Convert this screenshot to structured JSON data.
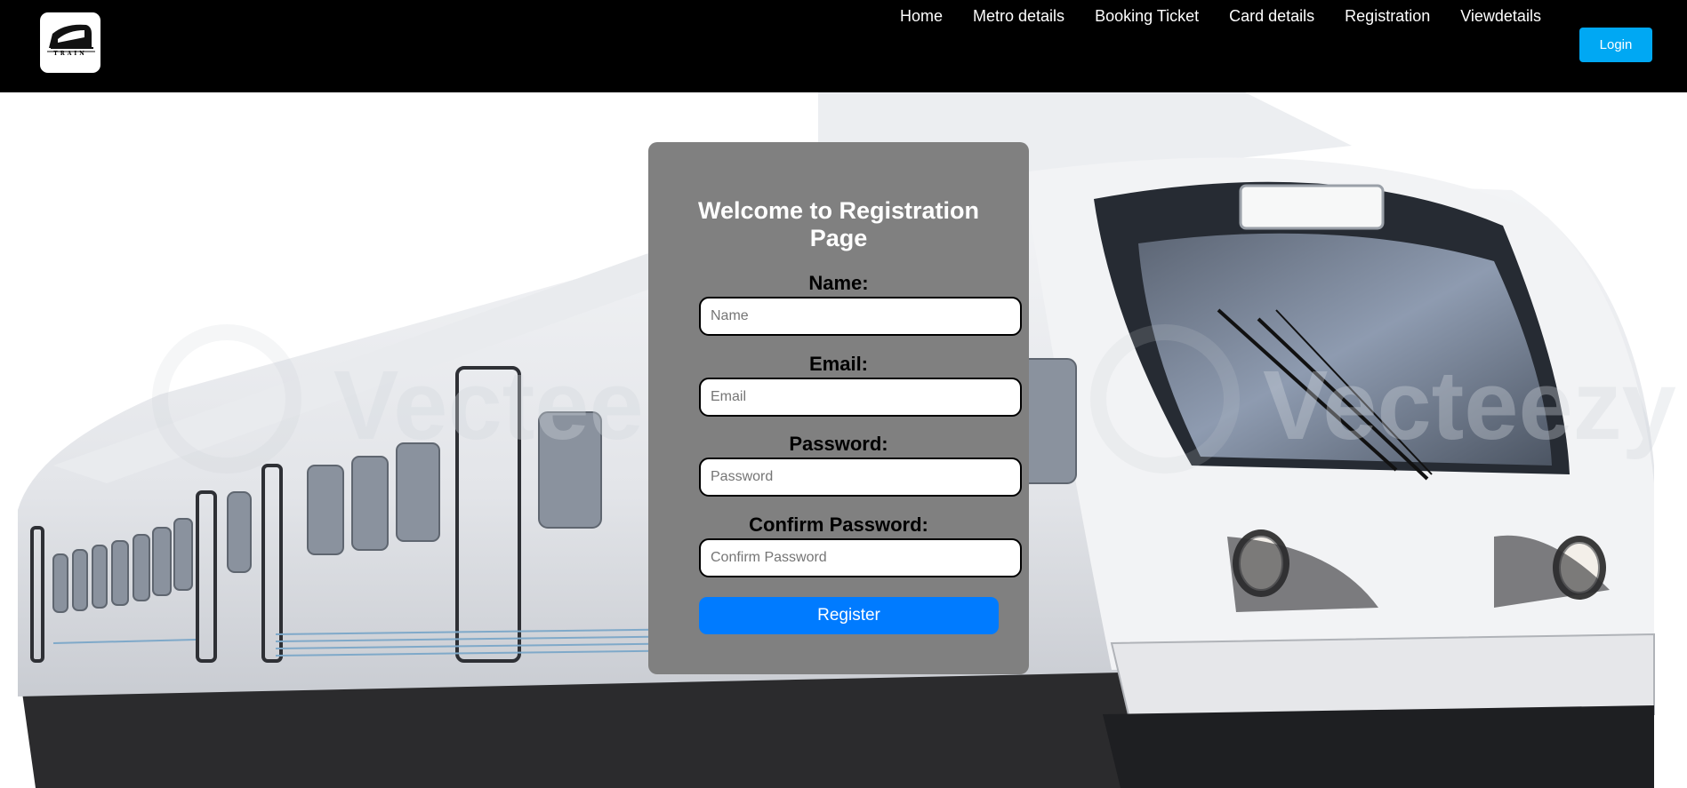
{
  "header": {
    "logo_text": "TRAIN",
    "nav": [
      "Home",
      "Metro details",
      "Booking Ticket",
      "Card details",
      "Registration",
      "Viewdetails"
    ],
    "login_label": "Login"
  },
  "hero": {
    "watermark": "Vecteezy"
  },
  "form": {
    "title": "Welcome to Registration Page",
    "name_label": "Name:",
    "name_placeholder": "Name",
    "email_label": "Email:",
    "email_placeholder": "Email",
    "password_label": "Password:",
    "password_placeholder": "Password",
    "confirm_label": "Confirm Password:",
    "confirm_placeholder": "Confirm Password",
    "register_label": "Register"
  },
  "colors": {
    "header_bg": "#000000",
    "login_button": "#00a8f3",
    "card_bg": "#808080",
    "register_button": "#007bff"
  }
}
